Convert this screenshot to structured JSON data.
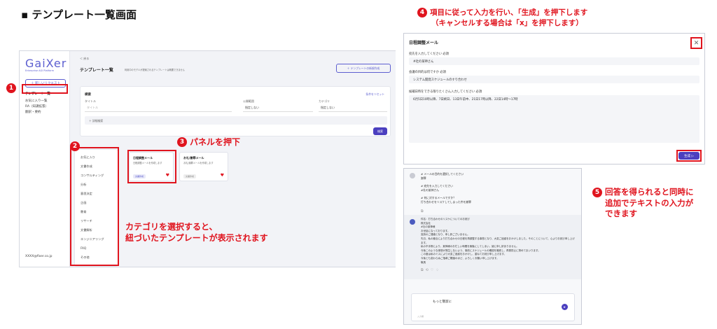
{
  "page_title": "▪ テンプレート一覧画面",
  "annotations": {
    "a1_num": "1",
    "a2_num": "2",
    "a3_num": "3",
    "a3_text": "パネルを押下",
    "a4_num": "4",
    "a4_line1": "項目に従って入力を行い、「生成」を押下します",
    "a4_line2": "（キャンセルする場合は「x」を押下します）",
    "a5_num": "5",
    "a5_line1": "回答を得られると同時に",
    "a5_line2": "追加でテキストの入力が",
    "a5_line3": "できます",
    "cat_line1": "カテゴリを選択すると、",
    "cat_line2": "紐づいたテンプレートが表示されます"
  },
  "app": {
    "logo": "GaiXer",
    "logo_sub": "Enterprise AGI Platform",
    "new_request": "＋ 新しいリクエスト",
    "side_items": [
      "テンプレート一覧",
      "お気に入り一覧",
      "RA（知識拡張）",
      "翻訳・要約"
    ],
    "user": "XXXX@fixer.co.jp",
    "back": "＜ 戻る",
    "page_heading": "テンプレート一覧",
    "page_desc": "利用中のモデルが提案されるテンプレートは概要できません",
    "new_template_btn": "＋ テンプレートの新規作成",
    "search_title": "検索",
    "reset": "条件をリセット",
    "title_label": "タイトル",
    "title_placeholder": "タイトル",
    "scope_label": "公開範囲",
    "scope_value": "指定しない",
    "category_label": "カテゴリ",
    "category_value": "指定しない",
    "detail": "＋ 詳細検索",
    "search_btn": "検索",
    "categories": [
      "お気に入り",
      "文書作成",
      "コンサルティング",
      "分析",
      "意思決定",
      "企画",
      "教育",
      "リサーチ",
      "文書解析",
      "エンジニアリング",
      "FAQ",
      "その他"
    ],
    "cards": [
      {
        "title": "日程調整メール",
        "desc": "日程調整メールを作成します",
        "tag": "文書作成"
      },
      {
        "title": "お礼/謝罪メール",
        "desc": "お礼/謝罪メールを作成します",
        "tag": "文書作成"
      }
    ]
  },
  "form": {
    "title": "日程調整メール",
    "close": "✕",
    "q1": "宛先を入力してください 必須",
    "a1": "#社の某神さん",
    "q2": "会議の目的は何ですか 必須",
    "a2": "システム開発スケジュールのすり合わせ",
    "q3": "候補日時をできる限りたくさん入力してください 必須",
    "a3": "6月5日10時以降、7日終日、13日午前中、21日17時以降、22日14時〜17時",
    "generate": "生成 ▷"
  },
  "chat": {
    "user_lines": [
      "# メールの目的を選択してください",
      "謝罪",
      "",
      "# 宛先を入力してください",
      "#社の某神さん",
      "",
      "# 何に対するメールですか？",
      "打ち合わせをリスケしてしまった件を謝罪"
    ],
    "bot_lines": [
      "件名：打ち合わせのリスケについてのお詫び",
      "株式会社",
      "#社の某神様",
      "お世話になっております。",
      "突然のご連絡となり、申し訳ございません。",
      "先日、私の都合により打ち合わせの日程を再調整する事態となり、大変ご迷惑をおかけしました。そのことについて、心よりお詫び申し上げます。",
      "私の不手際により、某神様のお忙しい時間を無駄にしてしまい、誠に申し訳ありません。",
      "今後このような事態が発生しないよう、事前にスケジュールの確認を徹底し、再発防止に努めてまいります。",
      "この度は私のミスにより大変ご迷惑をおかけし、重ねてお詫び申し上げます。",
      "今後とも変わらぬご指導ご鞭撻のほど、よろしくお願い申し上げます。",
      "敬具"
    ],
    "input_text": "もっと簡潔に",
    "input_hint": "入力欄"
  }
}
